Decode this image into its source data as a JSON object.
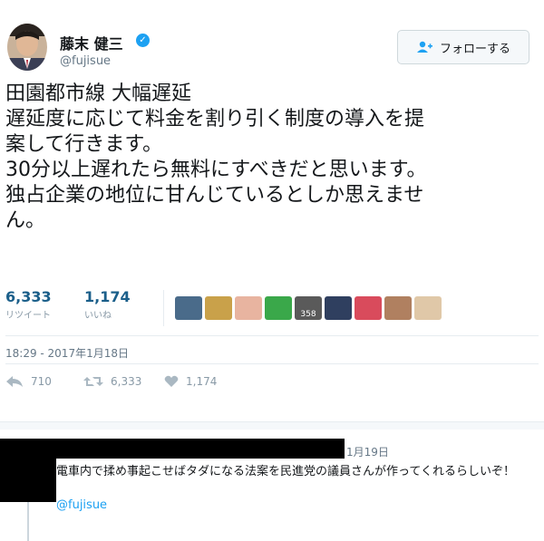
{
  "tweet": {
    "author_name": "藤末 健三",
    "author_handle": "@fujisue",
    "follow_label": "フォローする",
    "lines": [
      "田園都市線 大幅遅延",
      "遅延度に応じて料金を割り引く制度の導入を提",
      "案して行きます。",
      "30分以上遅れたら無料にすべきだと思います。",
      "独占企業の地位に甘んじているとしか思えませ",
      "ん。"
    ],
    "retweets_count": "6,333",
    "retweets_label": "リツイート",
    "likes_count": "1,174",
    "likes_label": "いいね",
    "likers_badge": "358",
    "timestamp": "18:29 - 2017年1月18日",
    "actions": {
      "reply_count": "710",
      "retweet_count": "6,333",
      "like_count": "1,174"
    }
  },
  "reply": {
    "date": "1月19日",
    "text": "電車内で揉め事起こせばタダになる法案を民進党の議員さんが作ってくれるらしいぞ！",
    "mention": "@fujisue"
  },
  "colors": {
    "accent": "#1da1f2",
    "stat_number": "#1b5f8a",
    "muted": "#657786",
    "redaction": "#000000"
  },
  "icons": [
    "verified-badge-icon",
    "follow-user-icon",
    "reply-icon",
    "retweet-icon",
    "heart-icon"
  ]
}
